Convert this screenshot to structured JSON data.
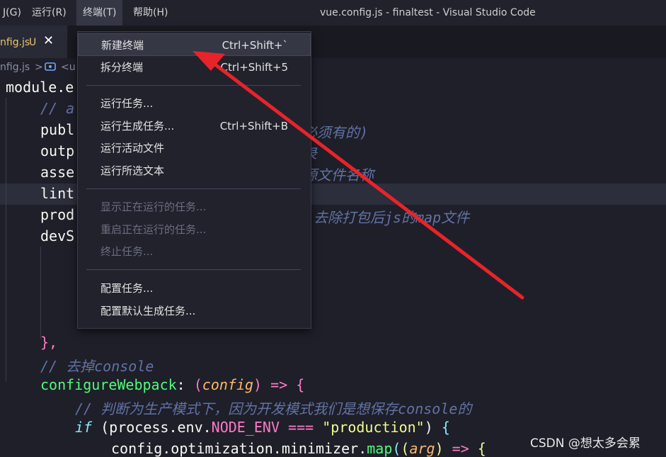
{
  "titlebar": {
    "menu": [
      "J(G)",
      "运行(R)",
      "终端(T)",
      "帮助(H)"
    ],
    "window_title": "vue.config.js - finaltest - Visual Studio Code"
  },
  "tab": {
    "label": "nfig.js",
    "status": "U",
    "close": "✕"
  },
  "breadcrumb": {
    "file": "nfig.js",
    "sep": ">",
    "symbol_tail": "<u"
  },
  "terminal_menu": {
    "items": [
      {
        "label": "新建终端",
        "shortcut": "Ctrl+Shift+`"
      },
      {
        "label": "拆分终端",
        "shortcut": "Ctrl+Shift+5"
      },
      {
        "label": "运行任务..."
      },
      {
        "label": "运行生成任务...",
        "shortcut": "Ctrl+Shift+B"
      },
      {
        "label": "运行活动文件"
      },
      {
        "label": "运行所选文本"
      },
      {
        "label": "显示正在运行的任务..."
      },
      {
        "label": "重启正在运行的任务..."
      },
      {
        "label": "终止任务..."
      },
      {
        "label": "配置任务..."
      },
      {
        "label": "配置默认生成任务..."
      }
    ]
  },
  "code": {
    "l1": "module.e",
    "l2": "// a",
    "l3a": "publ",
    "l3b": "必须有的)",
    "l4a": "outp",
    "l4b": "录",
    "l5a": "asse",
    "l5b": "源文件名称",
    "l6a": "lint",
    "l7a": "prod",
    "l7b": "去除打包后js的map文件",
    "l8a": "devS",
    "l9": "},",
    "l10": "// 去掉console",
    "l11_fn": "configureWebpack",
    "l11_colon": ": ",
    "l11_open": "(",
    "l11_param": "config",
    "l11_close": ")",
    "l11_arrow": " => ",
    "l11_brace": "{",
    "l12": "// 判断为生产模式下，因为开发模式我们是想保存console的",
    "l13_if": "if",
    "l13_a": " (process.env.",
    "l13_env": "NODE_ENV",
    "l13_op": " === ",
    "l13_str": "\"production\"",
    "l13_b": ") ",
    "l13_brace": "{",
    "l14_a": "config.optimization.minimizer.",
    "l14_map": "map",
    "l14_o": "(",
    "l14_o2": "(",
    "l14_arg": "arg",
    "l14_c": ")",
    "l14_arrow": " => ",
    "l14_brace": "{"
  },
  "watermark": "CSDN @想太多会累"
}
